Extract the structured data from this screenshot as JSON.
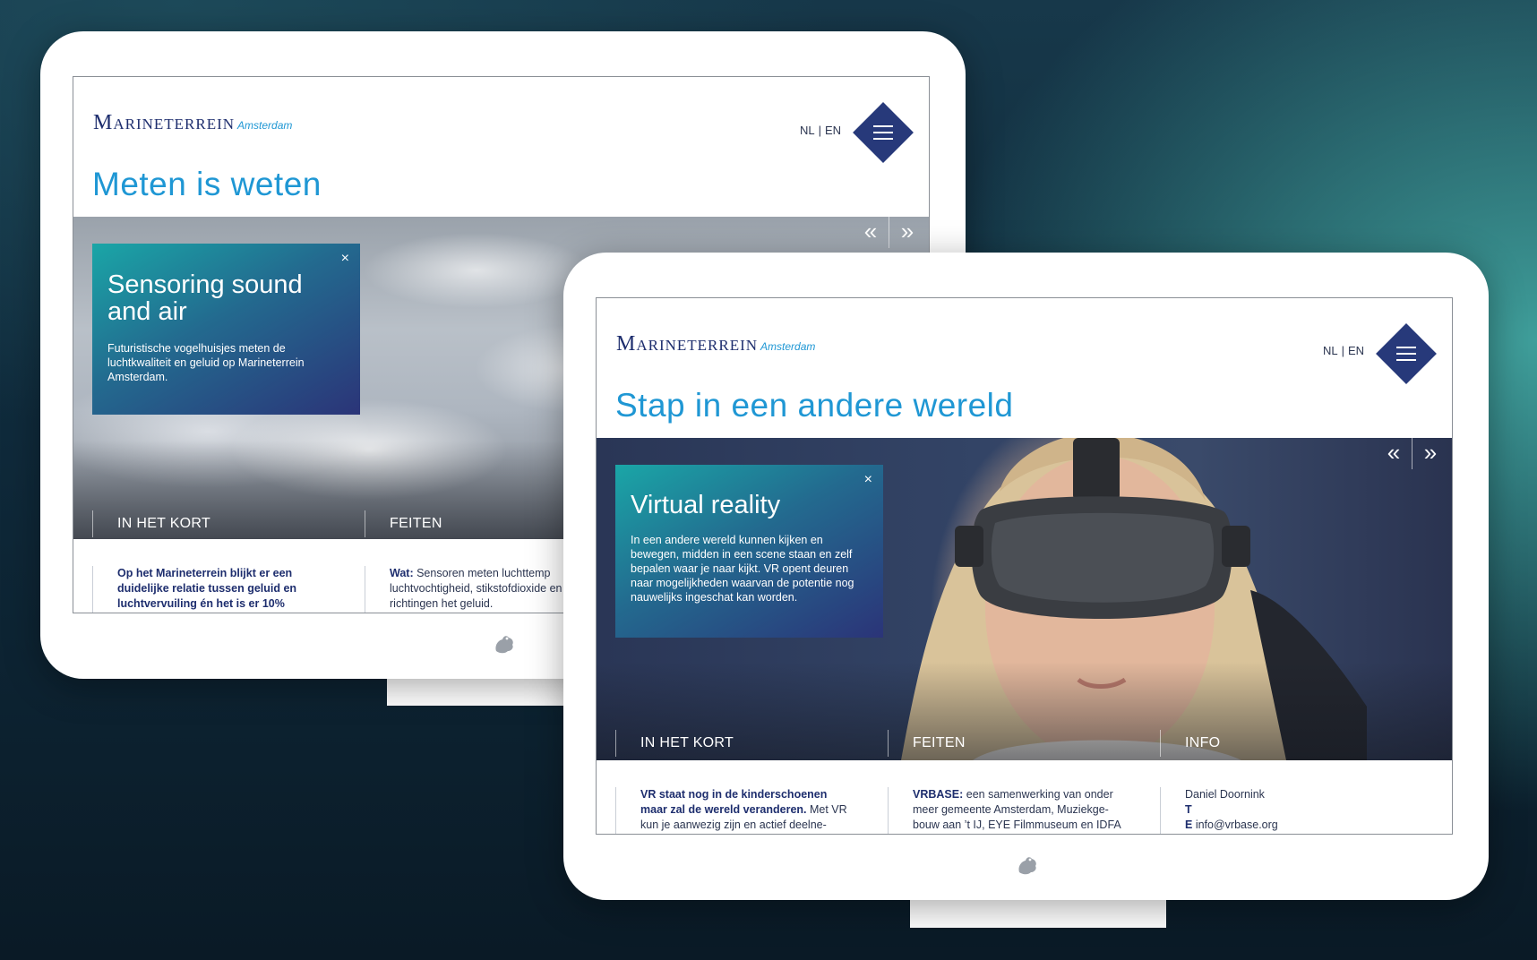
{
  "devices": [
    {
      "logo": {
        "brand": "Marineterrein",
        "city": "Amsterdam"
      },
      "lang": {
        "nl": "NL",
        "sep": "|",
        "en": "EN"
      },
      "title": "Meten is weten",
      "nav": {
        "prev": "«",
        "next": "»"
      },
      "card": {
        "close": "×",
        "heading": "Sensoring sound and air",
        "body": "Futuristische vogelhuisjes meten de luchtkwaliteit en geluid op Marineterrein Amsterdam."
      },
      "tabs": [
        "IN HET KORT",
        "FEITEN"
      ],
      "columns": [
        {
          "bold": "Op het Marineterrein blijkt er een duidelijke relatie tussen geluid en luchtvervuiling én het is er 10%",
          "text": ""
        },
        {
          "bold": "Wat:",
          "text": " Sensoren meten luchttemp luchtvochtigheid, stikstofdioxide en uit vier richtingen het geluid."
        }
      ]
    },
    {
      "logo": {
        "brand": "Marineterrein",
        "city": "Amsterdam"
      },
      "lang": {
        "nl": "NL",
        "sep": "|",
        "en": "EN"
      },
      "title": "Stap in een andere wereld",
      "nav": {
        "prev": "«",
        "next": "»"
      },
      "card": {
        "close": "×",
        "heading": "Virtual reality",
        "body": "In een andere wereld kunnen kijken en bewegen, midden in een scene staan en zelf bepalen waar je naar kijkt. VR opent deuren naar mogelijkheden waarvan de potentie nog nauwelijks ingeschat kan worden."
      },
      "tabs": [
        "IN HET KORT",
        "FEITEN",
        "INFO"
      ],
      "columns": [
        {
          "bold": "VR staat nog in de kinderschoenen maar zal de wereld veranderen.",
          "text": " Met VR kun je aanwezig zijn en actief deelne-"
        },
        {
          "bold": "VRBASE:",
          "text": " een samenwerking van onder meer gemeente Amsterdam, Muziekge-bouw aan ’t IJ, EYE Filmmuseum en IDFA"
        }
      ],
      "info": {
        "name": "Daniel Doornink",
        "t_label": "T",
        "e_label": "E",
        "email": "info@vrbase.org"
      }
    }
  ],
  "colors": {
    "accent": "#1f97d4",
    "navy": "#27397a",
    "card_start": "#1aa6a7",
    "card_end": "#2b3478"
  },
  "icons": [
    "chevron-double-left-icon",
    "chevron-double-right-icon",
    "close-icon",
    "hamburger-menu-icon",
    "frog-logo-icon"
  ]
}
